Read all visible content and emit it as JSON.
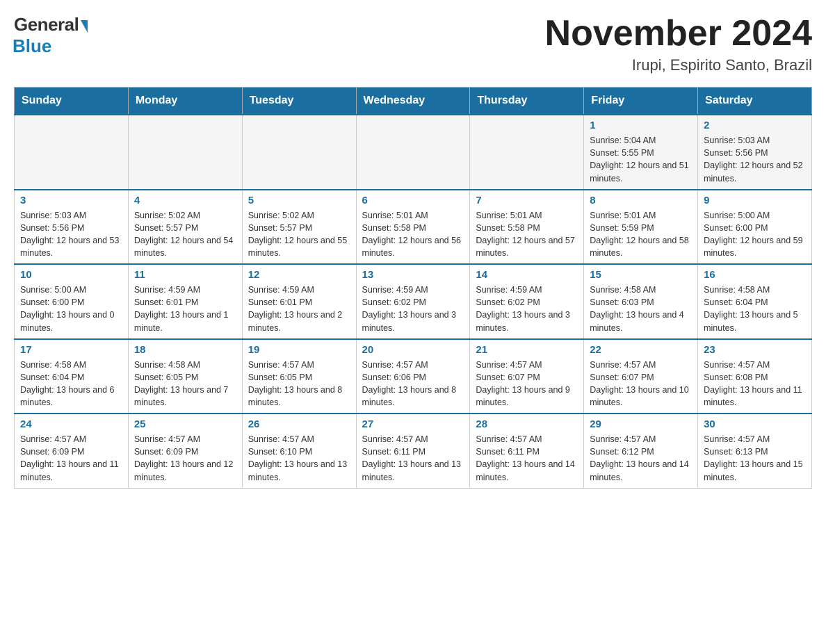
{
  "header": {
    "logo_general": "General",
    "logo_blue": "Blue",
    "month_title": "November 2024",
    "location": "Irupi, Espirito Santo, Brazil"
  },
  "days_of_week": [
    "Sunday",
    "Monday",
    "Tuesday",
    "Wednesday",
    "Thursday",
    "Friday",
    "Saturday"
  ],
  "weeks": [
    [
      {
        "day": "",
        "info": ""
      },
      {
        "day": "",
        "info": ""
      },
      {
        "day": "",
        "info": ""
      },
      {
        "day": "",
        "info": ""
      },
      {
        "day": "",
        "info": ""
      },
      {
        "day": "1",
        "info": "Sunrise: 5:04 AM\nSunset: 5:55 PM\nDaylight: 12 hours and 51 minutes."
      },
      {
        "day": "2",
        "info": "Sunrise: 5:03 AM\nSunset: 5:56 PM\nDaylight: 12 hours and 52 minutes."
      }
    ],
    [
      {
        "day": "3",
        "info": "Sunrise: 5:03 AM\nSunset: 5:56 PM\nDaylight: 12 hours and 53 minutes."
      },
      {
        "day": "4",
        "info": "Sunrise: 5:02 AM\nSunset: 5:57 PM\nDaylight: 12 hours and 54 minutes."
      },
      {
        "day": "5",
        "info": "Sunrise: 5:02 AM\nSunset: 5:57 PM\nDaylight: 12 hours and 55 minutes."
      },
      {
        "day": "6",
        "info": "Sunrise: 5:01 AM\nSunset: 5:58 PM\nDaylight: 12 hours and 56 minutes."
      },
      {
        "day": "7",
        "info": "Sunrise: 5:01 AM\nSunset: 5:58 PM\nDaylight: 12 hours and 57 minutes."
      },
      {
        "day": "8",
        "info": "Sunrise: 5:01 AM\nSunset: 5:59 PM\nDaylight: 12 hours and 58 minutes."
      },
      {
        "day": "9",
        "info": "Sunrise: 5:00 AM\nSunset: 6:00 PM\nDaylight: 12 hours and 59 minutes."
      }
    ],
    [
      {
        "day": "10",
        "info": "Sunrise: 5:00 AM\nSunset: 6:00 PM\nDaylight: 13 hours and 0 minutes."
      },
      {
        "day": "11",
        "info": "Sunrise: 4:59 AM\nSunset: 6:01 PM\nDaylight: 13 hours and 1 minute."
      },
      {
        "day": "12",
        "info": "Sunrise: 4:59 AM\nSunset: 6:01 PM\nDaylight: 13 hours and 2 minutes."
      },
      {
        "day": "13",
        "info": "Sunrise: 4:59 AM\nSunset: 6:02 PM\nDaylight: 13 hours and 3 minutes."
      },
      {
        "day": "14",
        "info": "Sunrise: 4:59 AM\nSunset: 6:02 PM\nDaylight: 13 hours and 3 minutes."
      },
      {
        "day": "15",
        "info": "Sunrise: 4:58 AM\nSunset: 6:03 PM\nDaylight: 13 hours and 4 minutes."
      },
      {
        "day": "16",
        "info": "Sunrise: 4:58 AM\nSunset: 6:04 PM\nDaylight: 13 hours and 5 minutes."
      }
    ],
    [
      {
        "day": "17",
        "info": "Sunrise: 4:58 AM\nSunset: 6:04 PM\nDaylight: 13 hours and 6 minutes."
      },
      {
        "day": "18",
        "info": "Sunrise: 4:58 AM\nSunset: 6:05 PM\nDaylight: 13 hours and 7 minutes."
      },
      {
        "day": "19",
        "info": "Sunrise: 4:57 AM\nSunset: 6:05 PM\nDaylight: 13 hours and 8 minutes."
      },
      {
        "day": "20",
        "info": "Sunrise: 4:57 AM\nSunset: 6:06 PM\nDaylight: 13 hours and 8 minutes."
      },
      {
        "day": "21",
        "info": "Sunrise: 4:57 AM\nSunset: 6:07 PM\nDaylight: 13 hours and 9 minutes."
      },
      {
        "day": "22",
        "info": "Sunrise: 4:57 AM\nSunset: 6:07 PM\nDaylight: 13 hours and 10 minutes."
      },
      {
        "day": "23",
        "info": "Sunrise: 4:57 AM\nSunset: 6:08 PM\nDaylight: 13 hours and 11 minutes."
      }
    ],
    [
      {
        "day": "24",
        "info": "Sunrise: 4:57 AM\nSunset: 6:09 PM\nDaylight: 13 hours and 11 minutes."
      },
      {
        "day": "25",
        "info": "Sunrise: 4:57 AM\nSunset: 6:09 PM\nDaylight: 13 hours and 12 minutes."
      },
      {
        "day": "26",
        "info": "Sunrise: 4:57 AM\nSunset: 6:10 PM\nDaylight: 13 hours and 13 minutes."
      },
      {
        "day": "27",
        "info": "Sunrise: 4:57 AM\nSunset: 6:11 PM\nDaylight: 13 hours and 13 minutes."
      },
      {
        "day": "28",
        "info": "Sunrise: 4:57 AM\nSunset: 6:11 PM\nDaylight: 13 hours and 14 minutes."
      },
      {
        "day": "29",
        "info": "Sunrise: 4:57 AM\nSunset: 6:12 PM\nDaylight: 13 hours and 14 minutes."
      },
      {
        "day": "30",
        "info": "Sunrise: 4:57 AM\nSunset: 6:13 PM\nDaylight: 13 hours and 15 minutes."
      }
    ]
  ]
}
